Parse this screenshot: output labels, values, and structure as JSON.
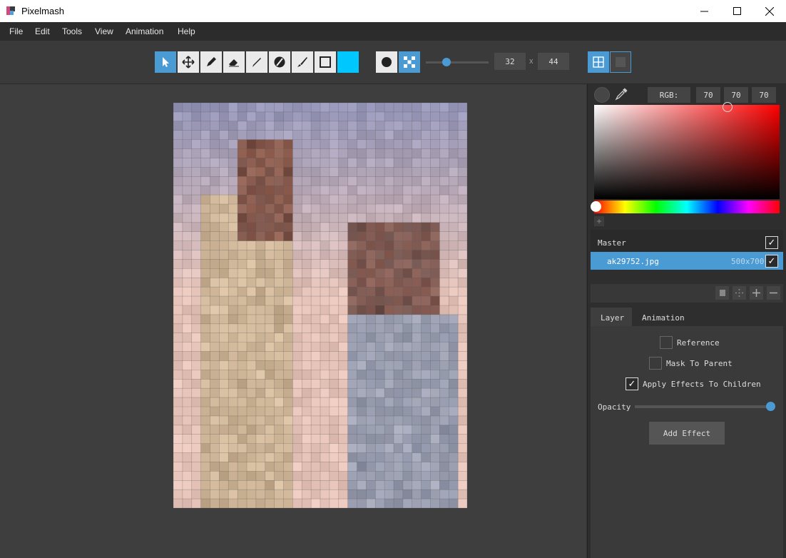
{
  "app": {
    "title": "Pixelmash"
  },
  "menu": [
    "File",
    "Edit",
    "Tools",
    "View",
    "Animation",
    "Help"
  ],
  "toolbar": {
    "brush_color": "#00c8ff",
    "size_value": "32",
    "size_separator": "x",
    "size_value2": "44"
  },
  "color": {
    "mode_label": "RGB:",
    "r": "70",
    "g": "70",
    "b": "70",
    "add_label": "+"
  },
  "layers": {
    "master_label": "Master",
    "items": [
      {
        "name": "ak29752.jpg",
        "size": "500x700"
      }
    ]
  },
  "tabs": [
    "Layer",
    "Animation"
  ],
  "layer_props": {
    "reference_label": "Reference",
    "mask_label": "Mask To Parent",
    "apply_label": "Apply Effects To Children",
    "opacity_label": "Opacity",
    "opacity": 1.0,
    "add_effect_label": "Add Effect"
  }
}
